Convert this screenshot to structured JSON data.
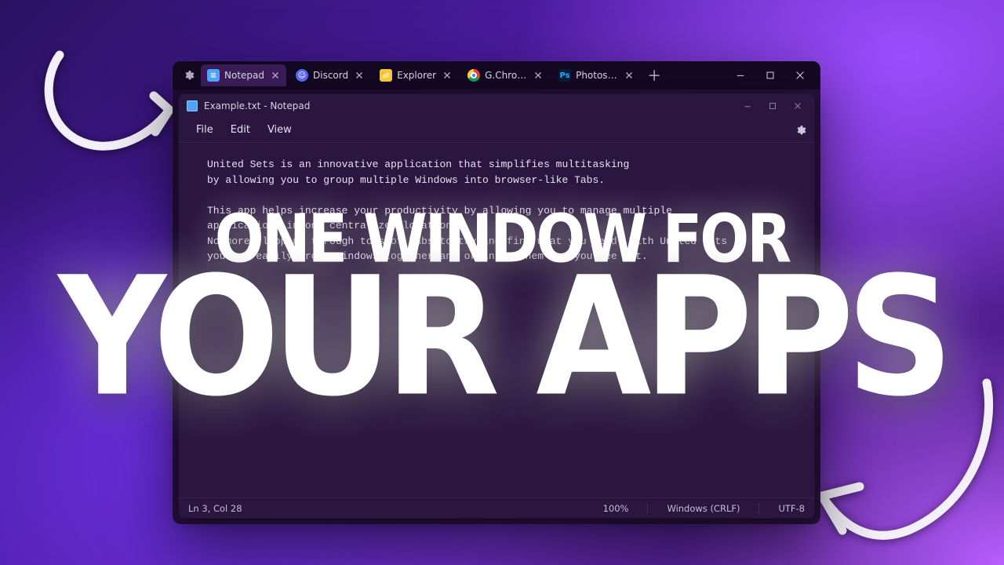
{
  "promo": {
    "line1": "ONE WINDOW FOR",
    "line2": "YOUR APPS"
  },
  "host": {
    "tabs": [
      {
        "label": "Notepad",
        "icon": "notepad",
        "icon_bg": "#4da3ff",
        "icon_fg": "#ffffff",
        "active": true
      },
      {
        "label": "Discord",
        "icon": "discord",
        "icon_bg": "#5865F2",
        "icon_fg": "#ffffff",
        "active": false
      },
      {
        "label": "Explorer",
        "icon": "explorer",
        "icon_bg": "#f5c542",
        "icon_fg": "#2b6ed1",
        "active": false
      },
      {
        "label": "G.Chrome",
        "icon": "chrome",
        "icon_bg": "#ffffff",
        "icon_fg": "#d6483a",
        "active": false
      },
      {
        "label": "Photoshop",
        "icon": "photoshop",
        "icon_bg": "#001e36",
        "icon_fg": "#31a8ff",
        "active": false
      }
    ]
  },
  "notepad": {
    "title": "Example.txt - Notepad",
    "menu": {
      "file": "File",
      "edit": "Edit",
      "view": "View"
    },
    "content": "United Sets is an innovative application that simplifies multitasking\nby allowing you to group multiple Windows into browser-like Tabs.\n\nThis app helps increase your productivity by allowing you to manage multiple\napplications in one centralized location.\nNo more flipping through tons of Tabs to try and find what you need. With United Sets\nyou can easily group Windows together and organize them how you see fit.",
    "status": {
      "position": "Ln 3, Col 28",
      "zoom": "100%",
      "eol": "Windows (CRLF)",
      "encoding": "UTF-8"
    }
  }
}
